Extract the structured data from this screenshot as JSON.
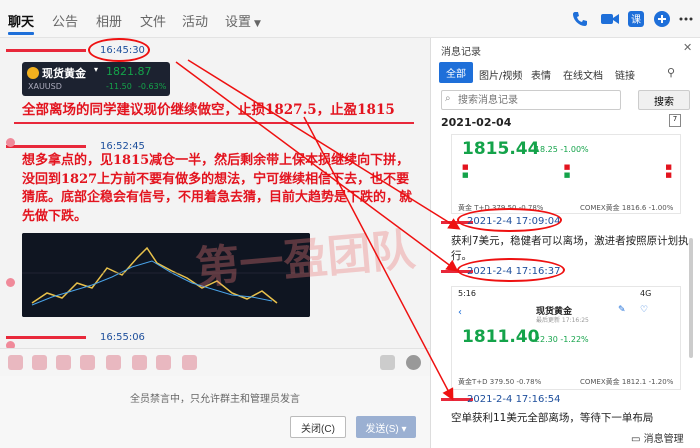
{
  "nav": {
    "tabs": [
      "聊天",
      "公告",
      "相册",
      "文件",
      "活动",
      "设置"
    ],
    "active_tab": "聊天"
  },
  "chat": {
    "msg1_time": "16:45:30",
    "quote": {
      "name": "现货黄金",
      "symbol": "XAUUSD",
      "price": "1821.87",
      "change": "-11.50",
      "pct": "-0.63%"
    },
    "announce": "全部离场的同学建议现价继续做空，止损1827.5，止盈1815",
    "msg2_time": "16:52:45",
    "advice": "想多拿点的，见1815减仓一半，然后剩余带上保本损继续向下拼，没回到1827上方前不要有做多的想法，宁可继续相信下去，也不要猜底。底部企稳会有信号，不用着急去猜，目前大趋势是下跌的，就先做下跌。",
    "msg3_time": "16:55:06",
    "watermark": "第一盈团队"
  },
  "composer": {
    "muted_note": "全员禁言中，只允许群主和管理员发言",
    "close_label": "关闭(C)",
    "send_label": "发送(S)"
  },
  "right_panel": {
    "title": "消息记录",
    "tabs": [
      "全部",
      "图片/视频",
      "表情",
      "在线文档",
      "链接"
    ],
    "search_placeholder": "搜索消息记录",
    "search_button": "搜索",
    "date": "2021-02-04",
    "card1": {
      "price": "1815.44",
      "change": "-18.25 -1.00%",
      "footer": "黄金 T+D  379.50 -0.78%",
      "footer2": "COMEX黄金  1816.6 -1.00%"
    },
    "msg_a_time": "2021-2-4 17:09:04",
    "msg_a_text": "获利7美元，稳健者可以离场，激进者按照原计划执行。",
    "msg_b_time": "2021-2-4 17:16:37",
    "phone": {
      "time": "5:16",
      "signal": "4G",
      "title": "现货黄金",
      "subtitle": "最后更新 17:16:25",
      "price": "1811.40",
      "change": "-22.30 -1.22%",
      "footer": "黄金T+D  379.50 -0.78%",
      "footer2": "COMEX黄金  1812.1 -1.20%"
    },
    "msg_c_time": "2021-2-4 17:16:54",
    "msg_c_text": "空单获利11美元全部离场，等待下一单布局",
    "footer_label": "消息管理"
  }
}
